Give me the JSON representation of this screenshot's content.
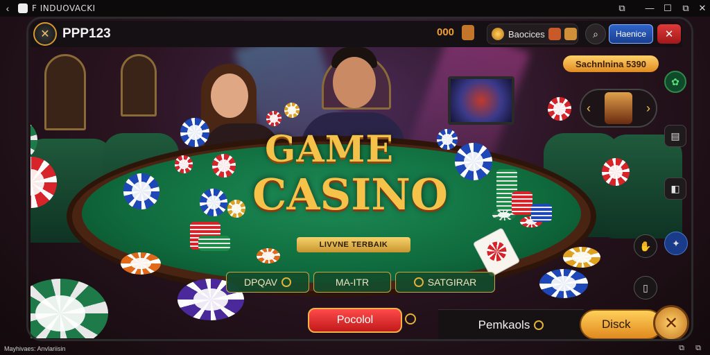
{
  "os": {
    "title": "F INDUOVACKI",
    "back": "‹",
    "controls": [
      "⧉",
      "—",
      "☐",
      "⧉",
      "✕"
    ]
  },
  "header": {
    "brand": "PPP123",
    "credit": "000",
    "resources_label": "Baocices",
    "blue_button": "Haenice",
    "red_button_icon": "✕"
  },
  "game": {
    "title_line1": "GAME",
    "title_line2": "CASINO",
    "tagline": "LIVVNE TERBAIK",
    "options": [
      "DPQAV",
      "MA-ITR",
      "SATGIRAR"
    ],
    "play_button": "Pocolol"
  },
  "sidebar": {
    "rank_label": "Sachnlnina 5390",
    "carousel_prev": "‹",
    "carousel_next": "›"
  },
  "bottom": {
    "panel_label": "Pemkaols",
    "deck_button": "Disck"
  },
  "footer": {
    "text": "Mayhivaes: Anvlariisin"
  },
  "colors": {
    "accent_gold": "#f4c24a",
    "felt_green": "#1d8c55",
    "play_red": "#e02a2a",
    "brand_blue": "#2d64c9"
  }
}
